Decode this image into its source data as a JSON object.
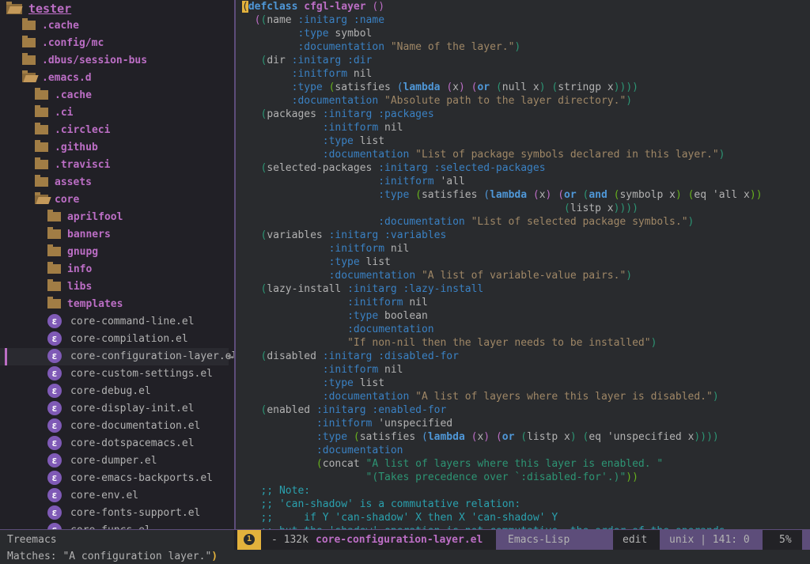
{
  "treemacs": {
    "root": "tester",
    "items": [
      {
        "label": ".cache",
        "kind": "dir",
        "depth": 1
      },
      {
        "label": ".config/mc",
        "kind": "dir",
        "depth": 1
      },
      {
        "label": ".dbus/session-bus",
        "kind": "dir",
        "depth": 1
      },
      {
        "label": ".emacs.d",
        "kind": "dir-open",
        "depth": 1
      },
      {
        "label": ".cache",
        "kind": "dir",
        "depth": 2
      },
      {
        "label": ".ci",
        "kind": "dir",
        "depth": 2
      },
      {
        "label": ".circleci",
        "kind": "dir",
        "depth": 2
      },
      {
        "label": ".github",
        "kind": "dir",
        "depth": 2
      },
      {
        "label": ".travisci",
        "kind": "dir",
        "depth": 2
      },
      {
        "label": "assets",
        "kind": "dir",
        "depth": 2
      },
      {
        "label": "core",
        "kind": "dir-open",
        "depth": 2
      },
      {
        "label": "aprilfool",
        "kind": "dir",
        "depth": 3
      },
      {
        "label": "banners",
        "kind": "dir",
        "depth": 3
      },
      {
        "label": "gnupg",
        "kind": "dir",
        "depth": 3
      },
      {
        "label": "info",
        "kind": "dir",
        "depth": 3
      },
      {
        "label": "libs",
        "kind": "dir",
        "depth": 3
      },
      {
        "label": "templates",
        "kind": "dir",
        "depth": 3
      },
      {
        "label": "core-command-line.el",
        "kind": "file",
        "depth": 3
      },
      {
        "label": "core-compilation.el",
        "kind": "file",
        "depth": 3
      },
      {
        "label": "core-configuration-layer.el",
        "kind": "file",
        "depth": 3,
        "selected": true
      },
      {
        "label": "core-custom-settings.el",
        "kind": "file",
        "depth": 3
      },
      {
        "label": "core-debug.el",
        "kind": "file",
        "depth": 3
      },
      {
        "label": "core-display-init.el",
        "kind": "file",
        "depth": 3
      },
      {
        "label": "core-documentation.el",
        "kind": "file",
        "depth": 3
      },
      {
        "label": "core-dotspacemacs.el",
        "kind": "file",
        "depth": 3
      },
      {
        "label": "core-dumper.el",
        "kind": "file",
        "depth": 3
      },
      {
        "label": "core-emacs-backports.el",
        "kind": "file",
        "depth": 3
      },
      {
        "label": "core-env.el",
        "kind": "file",
        "depth": 3
      },
      {
        "label": "core-fonts-support.el",
        "kind": "file",
        "depth": 3
      },
      {
        "label": "core-funcs.el",
        "kind": "file",
        "depth": 3
      }
    ]
  },
  "editor": {
    "lines": [
      [
        [
          "pcur",
          "("
        ],
        [
          "kw",
          "defclass"
        ],
        [
          "txt",
          " "
        ],
        [
          "fn",
          "cfgl-layer"
        ],
        [
          "txt",
          " "
        ],
        [
          "par2",
          "()"
        ]
      ],
      [
        [
          "txt",
          "  "
        ],
        [
          "par2",
          "("
        ],
        [
          "par3",
          "("
        ],
        [
          "txt",
          "name "
        ],
        [
          "kwd",
          ":initarg"
        ],
        [
          "txt",
          " "
        ],
        [
          "kwd",
          ":name"
        ]
      ],
      [
        [
          "txt",
          "         "
        ],
        [
          "kwd",
          ":type"
        ],
        [
          "txt",
          " symbol"
        ]
      ],
      [
        [
          "txt",
          "         "
        ],
        [
          "kwd",
          ":documentation"
        ],
        [
          "txt",
          " "
        ],
        [
          "doc",
          "\"Name of the layer.\""
        ],
        [
          "par3",
          ")"
        ]
      ],
      [
        [
          "txt",
          "   "
        ],
        [
          "par3",
          "("
        ],
        [
          "txt",
          "dir "
        ],
        [
          "kwd",
          ":initarg"
        ],
        [
          "txt",
          " "
        ],
        [
          "kwd",
          ":dir"
        ]
      ],
      [
        [
          "txt",
          "        "
        ],
        [
          "kwd",
          ":initform"
        ],
        [
          "txt",
          " nil"
        ]
      ],
      [
        [
          "txt",
          "        "
        ],
        [
          "kwd",
          ":type"
        ],
        [
          "txt",
          " "
        ],
        [
          "par4",
          "("
        ],
        [
          "txt",
          "satisfies "
        ],
        [
          "par",
          "("
        ],
        [
          "kw",
          "lambda"
        ],
        [
          "txt",
          " "
        ],
        [
          "par2",
          "("
        ],
        [
          "txt",
          "x"
        ],
        [
          "par2",
          ")"
        ],
        [
          "txt",
          " "
        ],
        [
          "par2",
          "("
        ],
        [
          "kw",
          "or"
        ],
        [
          "txt",
          " "
        ],
        [
          "par3",
          "("
        ],
        [
          "txt",
          "null x"
        ],
        [
          "par3",
          ")"
        ],
        [
          "txt",
          " "
        ],
        [
          "par3",
          "("
        ],
        [
          "txt",
          "stringp x"
        ],
        [
          "par3",
          "))))"
        ]
      ],
      [
        [
          "txt",
          "        "
        ],
        [
          "kwd",
          ":documentation"
        ],
        [
          "txt",
          " "
        ],
        [
          "doc",
          "\"Absolute path to the layer directory.\""
        ],
        [
          "par3",
          ")"
        ]
      ],
      [
        [
          "txt",
          "   "
        ],
        [
          "par3",
          "("
        ],
        [
          "txt",
          "packages "
        ],
        [
          "kwd",
          ":initarg"
        ],
        [
          "txt",
          " "
        ],
        [
          "kwd",
          ":packages"
        ]
      ],
      [
        [
          "txt",
          "             "
        ],
        [
          "kwd",
          ":initform"
        ],
        [
          "txt",
          " nil"
        ]
      ],
      [
        [
          "txt",
          "             "
        ],
        [
          "kwd",
          ":type"
        ],
        [
          "txt",
          " list"
        ]
      ],
      [
        [
          "txt",
          "             "
        ],
        [
          "kwd",
          ":documentation"
        ],
        [
          "txt",
          " "
        ],
        [
          "doc",
          "\"List of package symbols declared in this layer.\""
        ],
        [
          "par3",
          ")"
        ]
      ],
      [
        [
          "txt",
          "   "
        ],
        [
          "par3",
          "("
        ],
        [
          "txt",
          "selected-packages "
        ],
        [
          "kwd",
          ":initarg"
        ],
        [
          "txt",
          " "
        ],
        [
          "kwd",
          ":selected-packages"
        ]
      ],
      [
        [
          "txt",
          "                      "
        ],
        [
          "kwd",
          ":initform"
        ],
        [
          "txt",
          " 'all"
        ]
      ],
      [
        [
          "txt",
          "                      "
        ],
        [
          "kwd",
          ":type"
        ],
        [
          "txt",
          " "
        ],
        [
          "par4",
          "("
        ],
        [
          "txt",
          "satisfies "
        ],
        [
          "par",
          "("
        ],
        [
          "kw",
          "lambda"
        ],
        [
          "txt",
          " "
        ],
        [
          "par2",
          "("
        ],
        [
          "txt",
          "x"
        ],
        [
          "par2",
          ")"
        ],
        [
          "txt",
          " "
        ],
        [
          "par2",
          "("
        ],
        [
          "kw",
          "or"
        ],
        [
          "txt",
          " "
        ],
        [
          "par3",
          "("
        ],
        [
          "kw",
          "and"
        ],
        [
          "txt",
          " "
        ],
        [
          "par4",
          "("
        ],
        [
          "txt",
          "symbolp x"
        ],
        [
          "par4",
          ")"
        ],
        [
          "txt",
          " "
        ],
        [
          "par4",
          "("
        ],
        [
          "txt",
          "eq 'all x"
        ],
        [
          "par4",
          "))"
        ]
      ],
      [
        [
          "txt",
          "                                                    "
        ],
        [
          "par3",
          "("
        ],
        [
          "txt",
          "listp x"
        ],
        [
          "par3",
          "))))"
        ]
      ],
      [
        [
          "txt",
          "                      "
        ],
        [
          "kwd",
          ":documentation"
        ],
        [
          "txt",
          " "
        ],
        [
          "doc",
          "\"List of selected package symbols.\""
        ],
        [
          "par3",
          ")"
        ]
      ],
      [
        [
          "txt",
          "   "
        ],
        [
          "par3",
          "("
        ],
        [
          "txt",
          "variables "
        ],
        [
          "kwd",
          ":initarg"
        ],
        [
          "txt",
          " "
        ],
        [
          "kwd",
          ":variables"
        ]
      ],
      [
        [
          "txt",
          "              "
        ],
        [
          "kwd",
          ":initform"
        ],
        [
          "txt",
          " nil"
        ]
      ],
      [
        [
          "txt",
          "              "
        ],
        [
          "kwd",
          ":type"
        ],
        [
          "txt",
          " list"
        ]
      ],
      [
        [
          "txt",
          "              "
        ],
        [
          "kwd",
          ":documentation"
        ],
        [
          "txt",
          " "
        ],
        [
          "doc",
          "\"A list of variable-value pairs.\""
        ],
        [
          "par3",
          ")"
        ]
      ],
      [
        [
          "txt",
          "   "
        ],
        [
          "par3",
          "("
        ],
        [
          "txt",
          "lazy-install "
        ],
        [
          "kwd",
          ":initarg"
        ],
        [
          "txt",
          " "
        ],
        [
          "kwd",
          ":lazy-install"
        ]
      ],
      [
        [
          "txt",
          "                 "
        ],
        [
          "kwd",
          ":initform"
        ],
        [
          "txt",
          " nil"
        ]
      ],
      [
        [
          "txt",
          "                 "
        ],
        [
          "kwd",
          ":type"
        ],
        [
          "txt",
          " boolean"
        ]
      ],
      [
        [
          "txt",
          "                 "
        ],
        [
          "kwd",
          ":documentation"
        ]
      ],
      [
        [
          "txt",
          "                 "
        ],
        [
          "doc",
          "\"If non-nil then the layer needs to be installed\""
        ],
        [
          "par3",
          ")"
        ]
      ],
      [
        [
          "txt",
          "   "
        ],
        [
          "par3",
          "("
        ],
        [
          "txt",
          "disabled "
        ],
        [
          "kwd",
          ":initarg"
        ],
        [
          "txt",
          " "
        ],
        [
          "kwd",
          ":disabled-for"
        ]
      ],
      [
        [
          "txt",
          "             "
        ],
        [
          "kwd",
          ":initform"
        ],
        [
          "txt",
          " nil"
        ]
      ],
      [
        [
          "txt",
          "             "
        ],
        [
          "kwd",
          ":type"
        ],
        [
          "txt",
          " list"
        ]
      ],
      [
        [
          "txt",
          "             "
        ],
        [
          "kwd",
          ":documentation"
        ],
        [
          "txt",
          " "
        ],
        [
          "doc",
          "\"A list of layers where this layer is disabled.\""
        ],
        [
          "par3",
          ")"
        ]
      ],
      [
        [
          "txt",
          "   "
        ],
        [
          "par3",
          "("
        ],
        [
          "txt",
          "enabled "
        ],
        [
          "kwd",
          ":initarg"
        ],
        [
          "txt",
          " "
        ],
        [
          "kwd",
          ":enabled-for"
        ]
      ],
      [
        [
          "txt",
          "            "
        ],
        [
          "kwd",
          ":initform"
        ],
        [
          "txt",
          " 'unspecified"
        ]
      ],
      [
        [
          "txt",
          "            "
        ],
        [
          "kwd",
          ":type"
        ],
        [
          "txt",
          " "
        ],
        [
          "par4",
          "("
        ],
        [
          "txt",
          "satisfies "
        ],
        [
          "par",
          "("
        ],
        [
          "kw",
          "lambda"
        ],
        [
          "txt",
          " "
        ],
        [
          "par2",
          "("
        ],
        [
          "txt",
          "x"
        ],
        [
          "par2",
          ")"
        ],
        [
          "txt",
          " "
        ],
        [
          "par2",
          "("
        ],
        [
          "kw",
          "or"
        ],
        [
          "txt",
          " "
        ],
        [
          "par3",
          "("
        ],
        [
          "txt",
          "listp x"
        ],
        [
          "par3",
          ")"
        ],
        [
          "txt",
          " "
        ],
        [
          "par3",
          "("
        ],
        [
          "txt",
          "eq 'unspecified x"
        ],
        [
          "par3",
          "))))"
        ]
      ],
      [
        [
          "txt",
          "            "
        ],
        [
          "kwd",
          ":documentation"
        ]
      ],
      [
        [
          "txt",
          "            "
        ],
        [
          "par4",
          "("
        ],
        [
          "txt",
          "concat "
        ],
        [
          "str",
          "\"A list of layers where this layer is enabled. \""
        ]
      ],
      [
        [
          "txt",
          "                    "
        ],
        [
          "str",
          "\"(Takes precedence over `:disabled-for'.)\""
        ],
        [
          "par4",
          "))"
        ]
      ],
      [
        [
          "txt",
          "   "
        ],
        [
          "cmt",
          ";; Note:"
        ]
      ],
      [
        [
          "txt",
          "   "
        ],
        [
          "cmt",
          ";; 'can-shadow' is a commutative relation:"
        ]
      ],
      [
        [
          "txt",
          "   "
        ],
        [
          "cmt",
          ";;     if Y 'can-shadow' X then X 'can-shadow' Y"
        ]
      ],
      [
        [
          "txt",
          "   "
        ],
        [
          "cmt",
          ";; but the 'shadow' operation is not commutative, the order of the operands"
        ]
      ]
    ]
  },
  "modeline": {
    "treemacs_label": "Treemacs",
    "window_number": "1",
    "size": "- 132k",
    "filename": "core-configuration-layer.el",
    "major_mode": "Emacs-Lisp",
    "edit_state": "edit",
    "position": "unix | 141: 0",
    "percent": "5%"
  },
  "minibuffer": {
    "text": "Matches: \"A configuration layer.\"",
    "paren": ")"
  }
}
